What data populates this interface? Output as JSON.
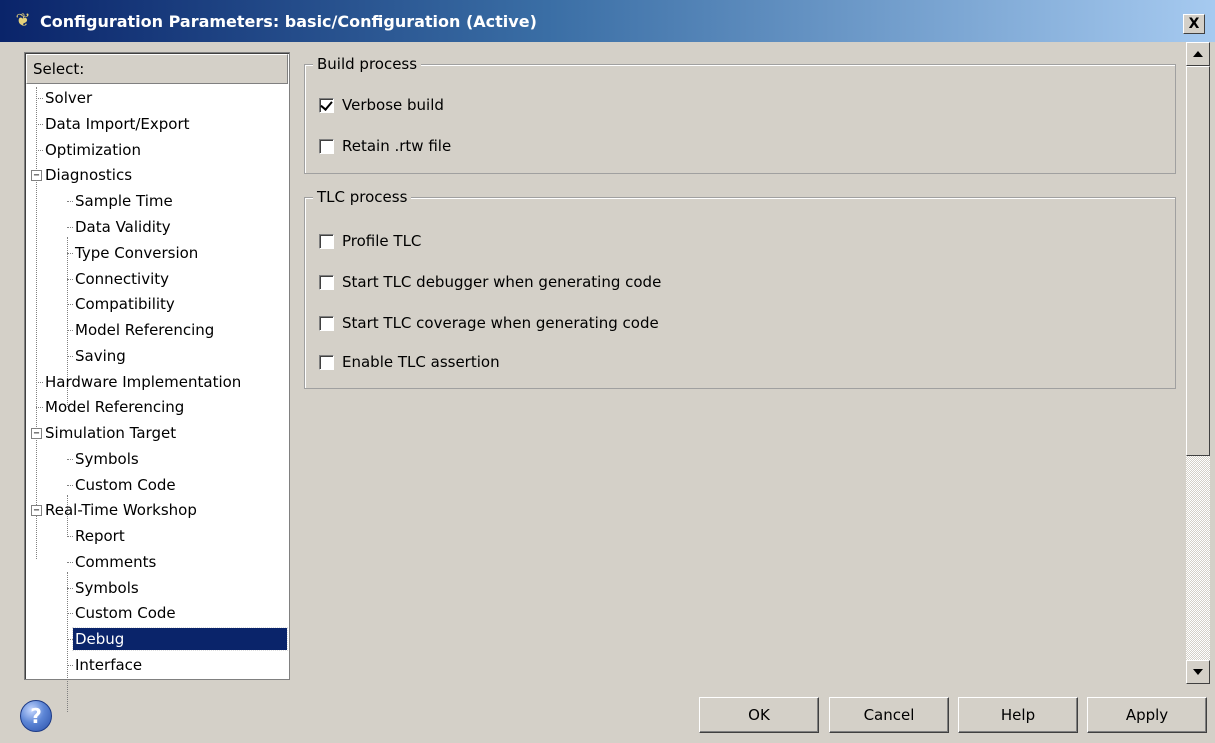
{
  "window": {
    "title": "Configuration Parameters: basic/Configuration (Active)",
    "close_label": "X"
  },
  "tree": {
    "header": "Select:",
    "items": [
      {
        "label": "Solver"
      },
      {
        "label": "Data Import/Export"
      },
      {
        "label": "Optimization"
      },
      {
        "label": "Diagnostics"
      },
      {
        "label": "Sample Time"
      },
      {
        "label": "Data Validity"
      },
      {
        "label": "Type Conversion"
      },
      {
        "label": "Connectivity"
      },
      {
        "label": "Compatibility"
      },
      {
        "label": "Model Referencing"
      },
      {
        "label": "Saving"
      },
      {
        "label": "Hardware Implementation"
      },
      {
        "label": "Model Referencing"
      },
      {
        "label": "Simulation Target"
      },
      {
        "label": "Symbols"
      },
      {
        "label": "Custom Code"
      },
      {
        "label": "Real-Time Workshop"
      },
      {
        "label": "Report"
      },
      {
        "label": "Comments"
      },
      {
        "label": "Symbols"
      },
      {
        "label": "Custom Code"
      },
      {
        "label": "Debug",
        "selected": true
      },
      {
        "label": "Interface"
      }
    ],
    "toggle_symbol": "−"
  },
  "build_process": {
    "legend": "Build process",
    "options": [
      {
        "label": "Verbose build",
        "checked": true
      },
      {
        "label": "Retain .rtw file",
        "checked": false
      }
    ]
  },
  "tlc_process": {
    "legend": "TLC process",
    "options": [
      {
        "label": "Profile TLC",
        "checked": false
      },
      {
        "label": "Start TLC debugger when generating code",
        "checked": false
      },
      {
        "label": "Start TLC coverage when generating code",
        "checked": false
      },
      {
        "label": "Enable TLC assertion",
        "checked": false
      }
    ]
  },
  "buttons": {
    "ok": "OK",
    "cancel": "Cancel",
    "help": "Help",
    "apply": "Apply"
  },
  "help_icon_glyph": "?",
  "icons": {
    "app": "simulink-tree-icon",
    "help": "help-circle-icon"
  }
}
